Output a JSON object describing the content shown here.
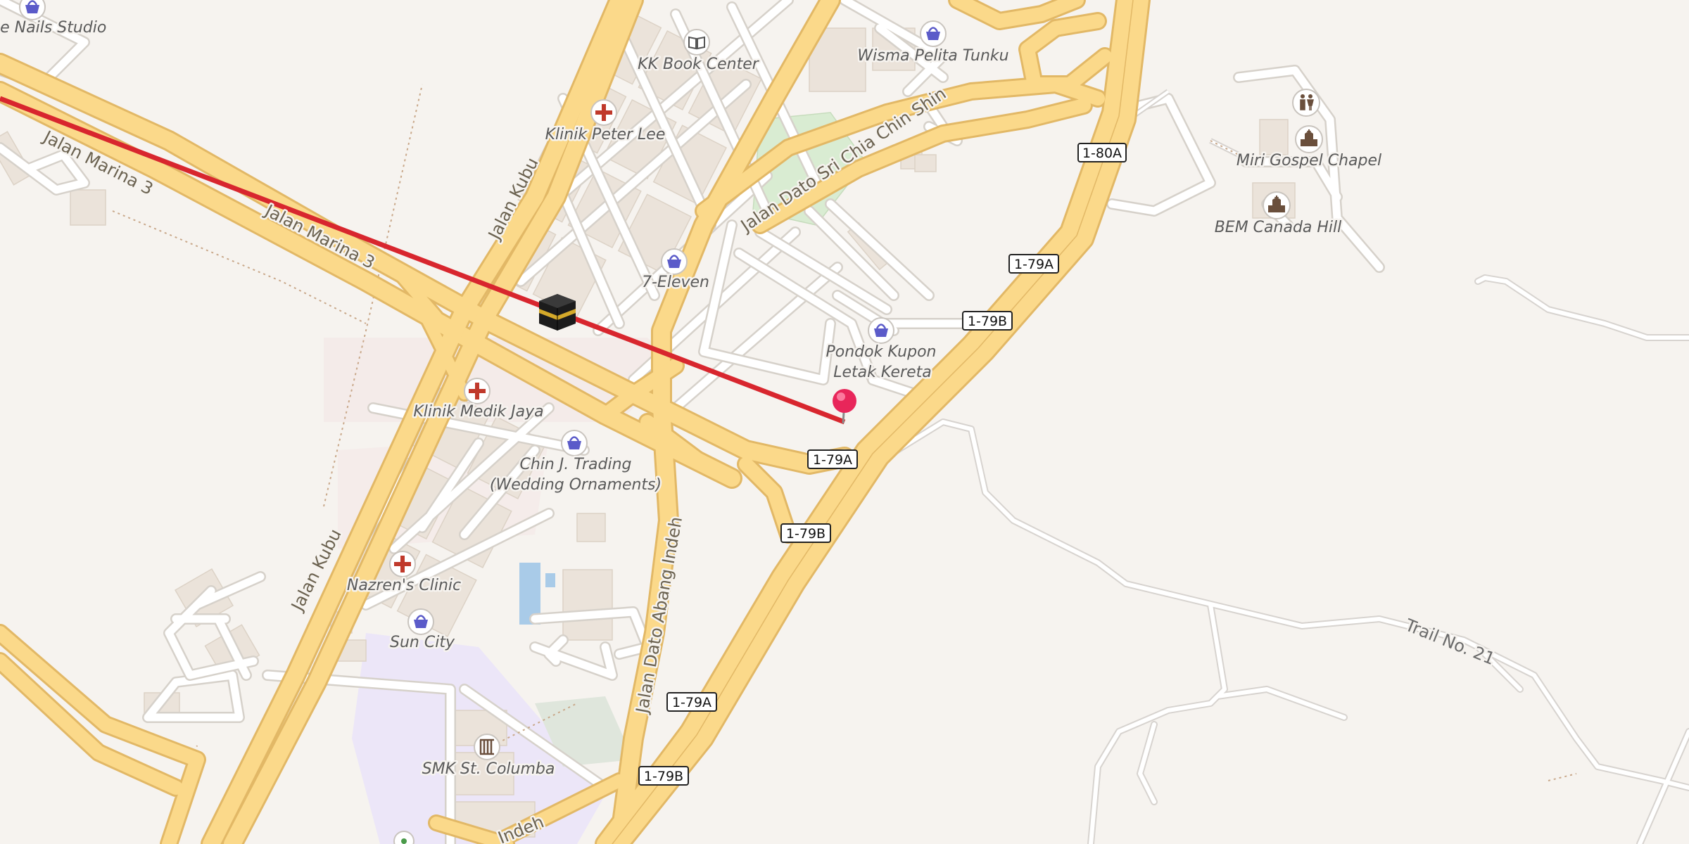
{
  "map": {
    "streets": [
      {
        "name": "Jalan Marina 3"
      },
      {
        "name": "Jalan Marina 3"
      },
      {
        "name": "Jalan Kubu"
      },
      {
        "name": "Jalan Kubu"
      },
      {
        "name": "Jalan Dato Sri Chia Chin Shin"
      },
      {
        "name": "Jalan Dato Abang Indeh"
      },
      {
        "name": "Indeh"
      },
      {
        "name": "Trail No. 21"
      }
    ],
    "pois": [
      {
        "label": "le Nails Studio",
        "icon": "shop-basket-icon"
      },
      {
        "label": "KK Book Center",
        "icon": "book-icon"
      },
      {
        "label": "Wisma Pelita Tunku",
        "icon": "shop-basket-icon"
      },
      {
        "label": "Klinik Peter Lee",
        "icon": "medical-cross-icon"
      },
      {
        "label": "7-Eleven",
        "icon": "shop-basket-icon"
      },
      {
        "label": "Pondok Kupon",
        "label2": "Letak Kereta",
        "icon": "shop-basket-icon"
      },
      {
        "label": "Klinik Medik Jaya",
        "icon": "medical-cross-icon"
      },
      {
        "label": "Chin J. Trading",
        "label2": "(Wedding Ornaments)",
        "icon": "shop-basket-icon"
      },
      {
        "label": "Nazren's Clinic",
        "icon": "medical-cross-icon"
      },
      {
        "label": "Sun City",
        "icon": "shop-basket-icon"
      },
      {
        "label": "SMK St. Columba",
        "icon": "school-icon"
      },
      {
        "label": "Miri Gospel Chapel",
        "icon": "church-icon"
      },
      {
        "label": "BEM Canada Hill",
        "icon": "church-icon"
      },
      {
        "label": "",
        "icon": "toilets-icon"
      }
    ],
    "route_shields": [
      "1-80A",
      "1-79A",
      "1-79B",
      "1-79A",
      "1-79B",
      "1-79A",
      "1-79B"
    ],
    "markers": [
      {
        "name": "kaaba-icon"
      },
      {
        "name": "location-pin-icon"
      }
    ],
    "colors": {
      "background": "#f6f3ef",
      "major_road": "#fbd98a",
      "major_road_casing": "#e2b866",
      "bearing_line": "#d8262e",
      "pin": "#e8265a",
      "shop_icon": "#5b5bc9",
      "medical_icon": "#c0392b"
    }
  }
}
